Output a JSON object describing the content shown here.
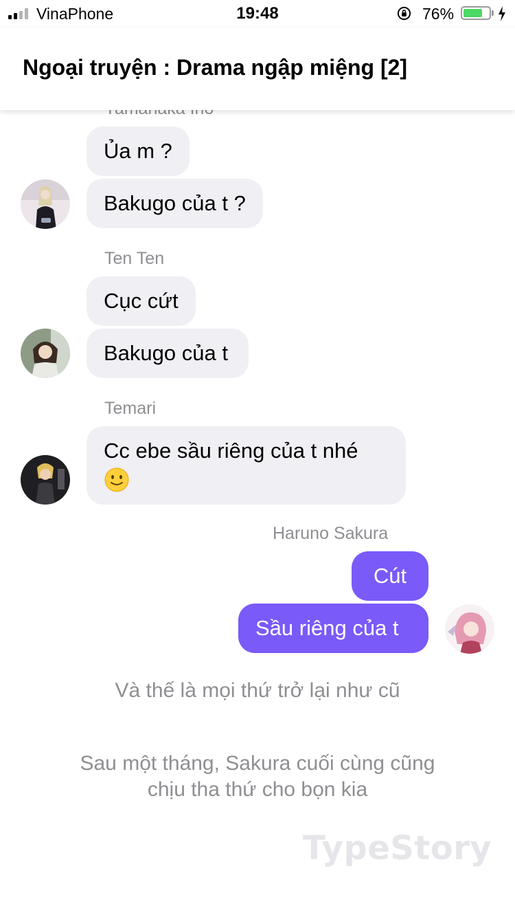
{
  "status_bar": {
    "carrier": "VinaPhone",
    "time": "19:48",
    "battery_percent_text": "76%",
    "battery_level": 0.76,
    "signal_bars_active": 2,
    "signal_bars_total": 4,
    "icons": [
      "signal-icon",
      "orientation-lock-icon",
      "battery-icon",
      "charging-bolt-icon"
    ]
  },
  "header": {
    "title": "Ngoại truyện : Drama ngập miệng [2]"
  },
  "messages": {
    "g1_sender": "Yamanaka Ino",
    "g1_m1": "Ủa m ?",
    "g1_m2": "Bakugo của t ?",
    "g2_sender": "Ten Ten",
    "g2_m1": "Cục cứt",
    "g2_m2": "Bakugo của t",
    "g3_sender": "Temari",
    "g3_m1": "Cc ebe sầu riêng của t nhé",
    "g3_emoji": "slightly-smiling-face-icon",
    "g4_sender": "Haruno Sakura",
    "g4_m1": "Cút",
    "g4_m2": "Sầu riêng của t"
  },
  "narration": {
    "line1": "Và thế là mọi thứ trở lại như cũ",
    "line2a": "Sau một tháng, Sakura cuối cùng cũng",
    "line2b": "chịu tha thứ cho bọn kia"
  },
  "watermark": "TypeStory",
  "colors": {
    "incoming_bubble": "#f0eff4",
    "outgoing_bubble": "#7a5af8",
    "sender_name": "#8e8e93",
    "battery_green": "#4cd964"
  }
}
